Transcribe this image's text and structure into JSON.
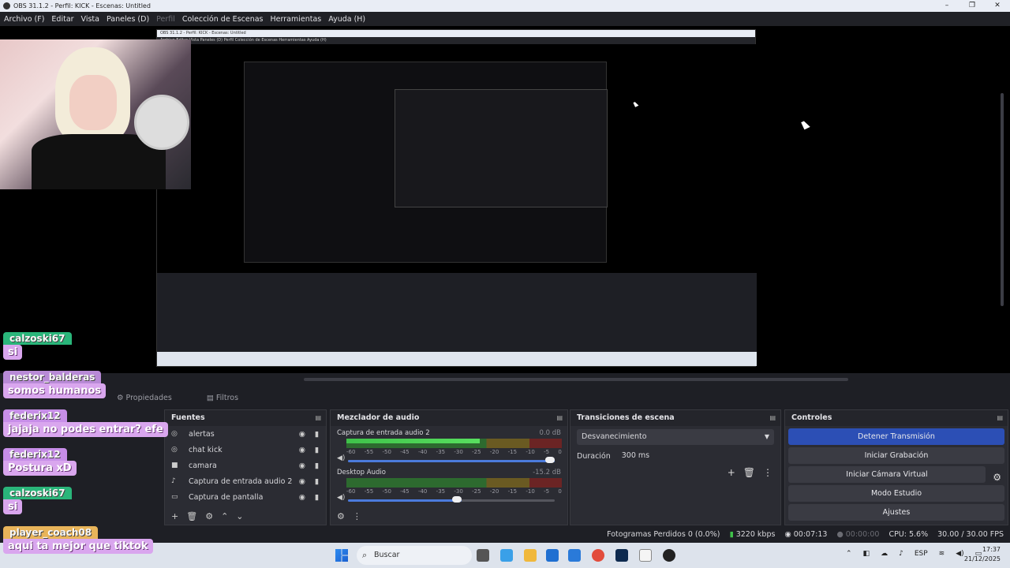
{
  "window": {
    "title": "OBS 31.1.2 - Perfil: KICK - Escenas: Untitled",
    "minimize": "–",
    "maximize": "❐",
    "close": "✕"
  },
  "menu": [
    "Archivo (F)",
    "Editar",
    "Vista",
    "Paneles (D)",
    "Perfil",
    "Colección de Escenas",
    "Herramientas",
    "Ayuda (H)"
  ],
  "nested": {
    "title": "OBS 31.1.2 - Perfil: KICK - Escenas: Untitled",
    "menu": "Archivo  Editar  Vista  Paneles (D)  Perfil  Colección de Escenas  Herramientas  Ayuda (H)"
  },
  "tabs": {
    "properties": "Propiedades",
    "filters": "Filtros"
  },
  "sources": {
    "title": "Fuentes",
    "items": [
      {
        "label": "alertas",
        "icon": "browser-icon"
      },
      {
        "label": "chat kick",
        "icon": "browser-icon"
      },
      {
        "label": "camara",
        "icon": "camera-icon"
      },
      {
        "label": "Captura de entrada audio 2",
        "icon": "mic-icon"
      },
      {
        "label": "Captura de pantalla",
        "icon": "monitor-icon"
      }
    ]
  },
  "mixer": {
    "title": "Mezclador de audio",
    "ticks": [
      "-60",
      "-55",
      "-50",
      "-45",
      "-40",
      "-35",
      "-30",
      "-25",
      "-20",
      "-15",
      "-10",
      "-5",
      "0"
    ],
    "channels": [
      {
        "name": "Captura de entrada audio 2",
        "db": "0.0 dB",
        "level": 0.62,
        "volume": 1.0
      },
      {
        "name": "Desktop Audio",
        "db": "-15.2 dB",
        "level": 0.0,
        "volume": 0.55
      }
    ]
  },
  "transitions": {
    "title": "Transiciones de escena",
    "selected": "Desvanecimiento",
    "duration_label": "Duración",
    "duration_value": "300 ms"
  },
  "controls": {
    "title": "Controles",
    "buttons": [
      "Detener Transmisión",
      "Iniciar Grabación",
      "Iniciar Cámara Virtual",
      "Modo Estudio",
      "Ajustes"
    ]
  },
  "status": {
    "dropped": "Fotogramas Perdidos 0 (0.0%)",
    "bitrate": "3220 kbps",
    "stream_time": "00:07:13",
    "rec_time": "00:00:00",
    "cpu": "CPU: 5.6%",
    "fps": "30.00 / 30.00 FPS"
  },
  "taskbar": {
    "search_placeholder": "Buscar",
    "lang": "ESP",
    "time": "17:37",
    "date": "21/12/2025"
  },
  "chat": [
    {
      "name": "calzoski67",
      "msg": "si",
      "color": "g"
    },
    {
      "name": "nestor_balderas",
      "msg": "somos humanos",
      "color": "mg"
    },
    {
      "name": "federix12",
      "msg": "jajaja no podes entrar? efe",
      "color": "p"
    },
    {
      "name": "federix12",
      "msg": "Postura xD",
      "color": "p"
    },
    {
      "name": "calzoski67",
      "msg": "si",
      "color": "g"
    },
    {
      "name": "player_coach08",
      "msg": "aqui ta mejor que tiktok",
      "color": "o"
    }
  ]
}
